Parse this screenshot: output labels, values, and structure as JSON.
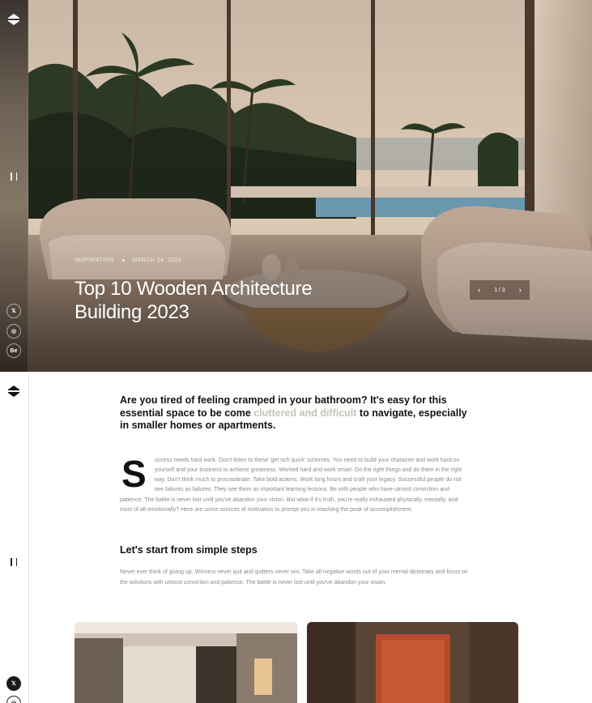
{
  "hero": {
    "category": "INSPIRATION",
    "date": "MARCH 24, 2024",
    "title": "Top 10 Wooden Architecture Building 2023",
    "pager": {
      "prev_icon": "chevron-left-icon",
      "next_icon": "chevron-right-icon",
      "count": "1 / 3"
    }
  },
  "sidebar": {
    "logo_icon": "brand-logo-icon",
    "menu_icon": "menu-toggle-icon",
    "social": [
      {
        "icon": "x-icon",
        "label": "𝕏"
      },
      {
        "icon": "instagram-icon",
        "label": "◎"
      },
      {
        "icon": "behance-icon",
        "label": "Be"
      }
    ]
  },
  "article": {
    "lead_before": "Are you tired of feeling cramped in your bathroom? It's easy for this essential space to be come ",
    "lead_highlight": "cluttered and difficult",
    "lead_after": " to navigate, especially in smaller homes or apartments.",
    "dropcap": "S",
    "body": "uccess needs hard work. Don't listen to these 'get rich quick' schemes. You need to build your character and work hard on yourself and your business to achieve greatness. Worked hard and work smart. Do the right things and do them in the right way. Don't think much to procrastinate. Take bold actions. Work long hours and craft your legacy. Successful people do not  see failures as failures. They see them as important learning lessons. Be with people who have utmost conviction and patience. The battle is never lost until you've abandon your vision. But what if it's truth, you're really exhausted physically, mentally, and most of all emotionally? Here are some sources of motivation to prompt you in reaching the peak of accomplishment.",
    "section_heading": "Let's start from simple steps",
    "section_text": "Never ever think of giving up. Winners never quit and quitters never win. Take all negative words out of your mental dictionary and focus on the solutions with utmost conviction and patience. The battle is never lost until you've abandon your vision."
  },
  "colors": {
    "accent_muted": "#c7c2bb",
    "text_dark": "#121212",
    "text_body": "#8a8a8a"
  }
}
